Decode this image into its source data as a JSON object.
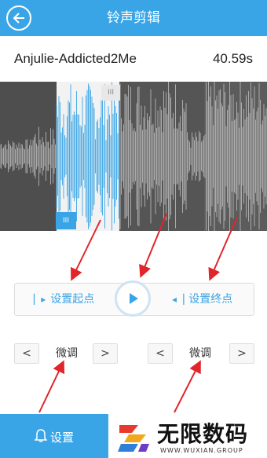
{
  "header": {
    "title": "铃声剪辑"
  },
  "song": {
    "name": "Anjulie-Addicted2Me",
    "duration": "40.59s"
  },
  "waveform": {
    "selection_start_handle": "III",
    "selection_end_handle": "III"
  },
  "controls": {
    "set_start_label": "设置起点",
    "set_end_label": "设置终点"
  },
  "fine_tune": {
    "left": {
      "label": "微调",
      "prev": "<",
      "next": ">"
    },
    "right": {
      "label": "微调",
      "prev": "<",
      "next": ">"
    }
  },
  "bottom_bar": {
    "settings_label": "设置"
  },
  "watermark": {
    "brand": "无限数码",
    "url": "WWW.WUXIAN.GROUP"
  },
  "colors": {
    "accent": "#3aa5e6",
    "annotation": "#e0262b",
    "wave_dark": "#555555"
  }
}
